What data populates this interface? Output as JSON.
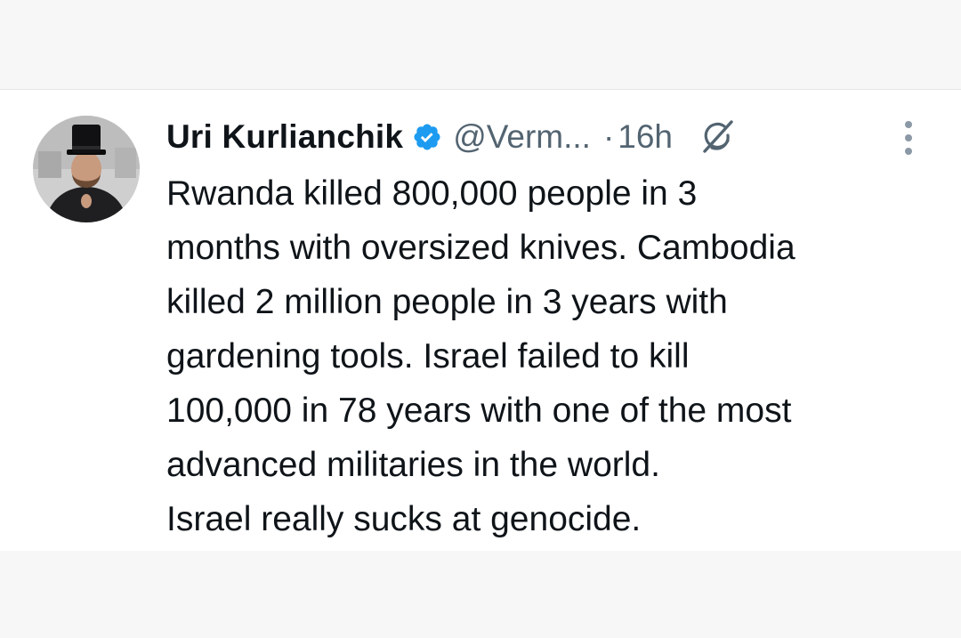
{
  "tweet": {
    "author": {
      "name": "Uri Kurlianchik",
      "handle": "@Verm...",
      "verified": true
    },
    "separator": "·",
    "time": "16h",
    "text": "Rwanda killed 800,000 people in 3\nmonths with oversized knives. Cambodia\nkilled 2 million people in 3 years with\ngardening tools. Israel failed to kill\n100,000 in 78 years with one of the most\nadvanced militaries in the world.\nIsrael really sucks at genocide."
  },
  "icons": {
    "verified": "verified-badge-icon",
    "grok": "grok-icon",
    "more": "more-vertical-icon"
  },
  "colors": {
    "verified_blue": "#1d9bf0",
    "text": "#0f1419",
    "secondary_text": "#536471",
    "background": "#ffffff",
    "frame": "#f7f7f8"
  }
}
